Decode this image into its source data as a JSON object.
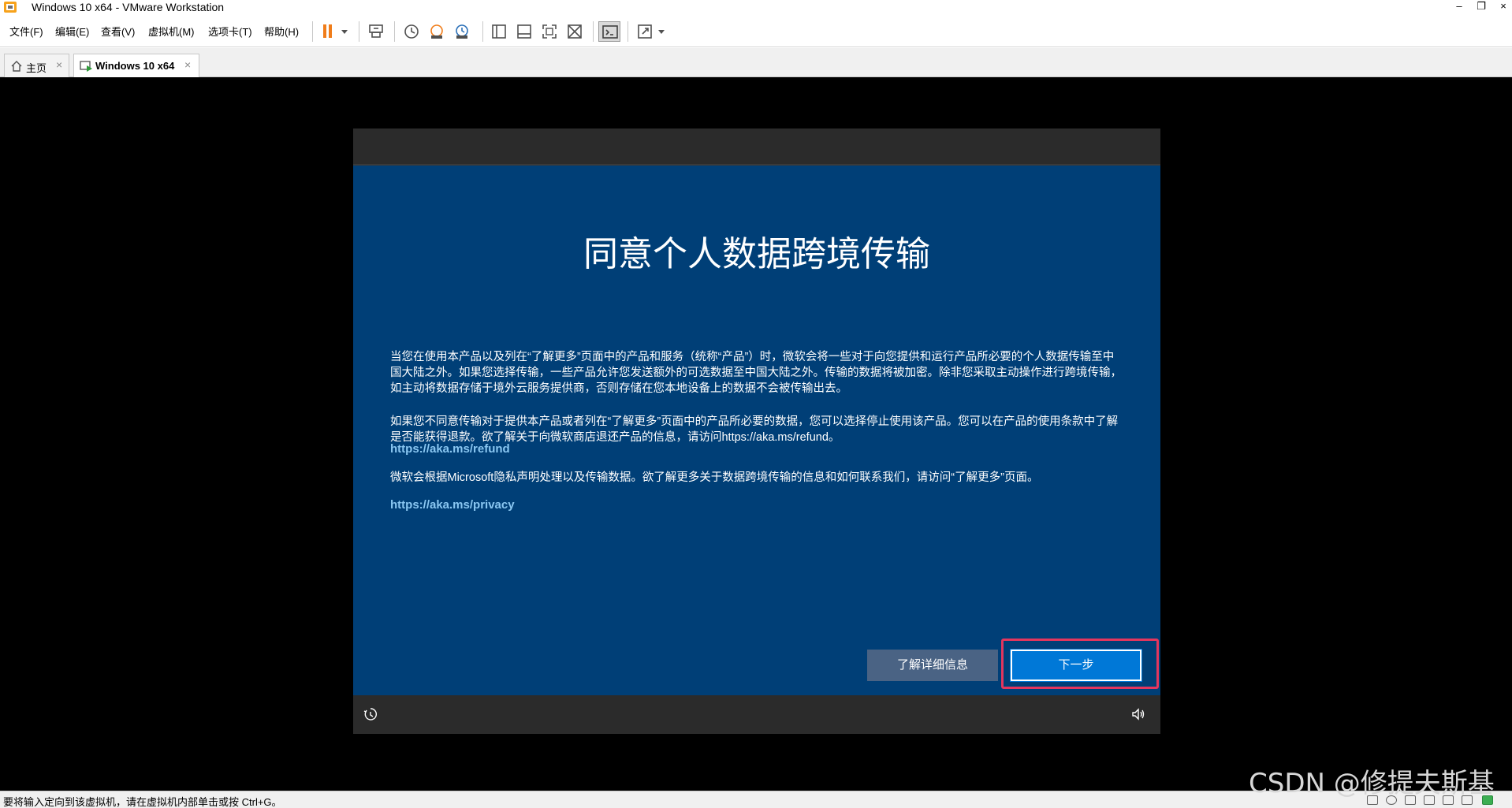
{
  "window": {
    "title": "Windows 10 x64 - VMware Workstation",
    "controls": {
      "minimize": "–",
      "restore": "❐",
      "close": "×"
    }
  },
  "menu": [
    {
      "label": "文件(F)"
    },
    {
      "label": "编辑(E)"
    },
    {
      "label": "查看(V)"
    },
    {
      "label": "虚拟机(M)"
    },
    {
      "label": "选项卡(T)"
    },
    {
      "label": "帮助(H)"
    }
  ],
  "toolbar": {
    "icons": [
      "pause-icon",
      "dropdown-arrow-icon",
      "send-ctrl-alt-del-icon",
      "snapshot-icon",
      "revert-snapshot-icon",
      "snapshot-manager-icon",
      "library-view-icon",
      "thumbnail-view-icon",
      "fullscreen-icon",
      "unity-icon",
      "console-view-icon",
      "stretch-icon",
      "dropdown-arrow-icon"
    ],
    "accent": "#f07d1a"
  },
  "tabs": [
    {
      "label": "主页",
      "active": false,
      "close": "×"
    },
    {
      "label": "Windows 10 x64",
      "active": true,
      "close": "×"
    }
  ],
  "oobe": {
    "title": "同意个人数据跨境传输",
    "paragraphs": [
      "当您在使用本产品以及列在“了解更多”页面中的产品和服务（统称“产品”）时，微软会将一些对于向您提供和运行产品所必要的个人数据传输至中国大陆之外。如果您选择传输，一些产品允许您发送额外的可选数据至中国大陆之外。传输的数据将被加密。除非您采取主动操作进行跨境传输，如主动将数据存储于境外云服务提供商，否则存储在您本地设备上的数据不会被传输出去。",
      "如果您不同意传输对于提供本产品或者列在“了解更多”页面中的产品所必要的数据，您可以选择停止使用该产品。您可以在产品的使用条款中了解是否能获得退款。欲了解关于向微软商店退还产品的信息，请访问https://aka.ms/refund。",
      "微软会根据Microsoft隐私声明处理以及传输数据。欲了解更多关于数据跨境传输的信息和如何联系我们，请访问“了解更多”页面。"
    ],
    "links": [
      "https://aka.ms/refund",
      "https://aka.ms/privacy"
    ],
    "learn_more_button": "了解详细信息",
    "next_button": "下一步",
    "panel_color": "#003f77",
    "link_color": "#8ac7f2",
    "primary_button_color": "#0078d7",
    "highlight_color": "#e4365e",
    "bottom_icons": [
      "ease-of-access-icon",
      "volume-icon"
    ]
  },
  "status": {
    "text": "要将输入定向到该虚拟机，请在虚拟机内部单击或按 Ctrl+G。"
  },
  "watermark": "CSDN @修提夫斯基"
}
